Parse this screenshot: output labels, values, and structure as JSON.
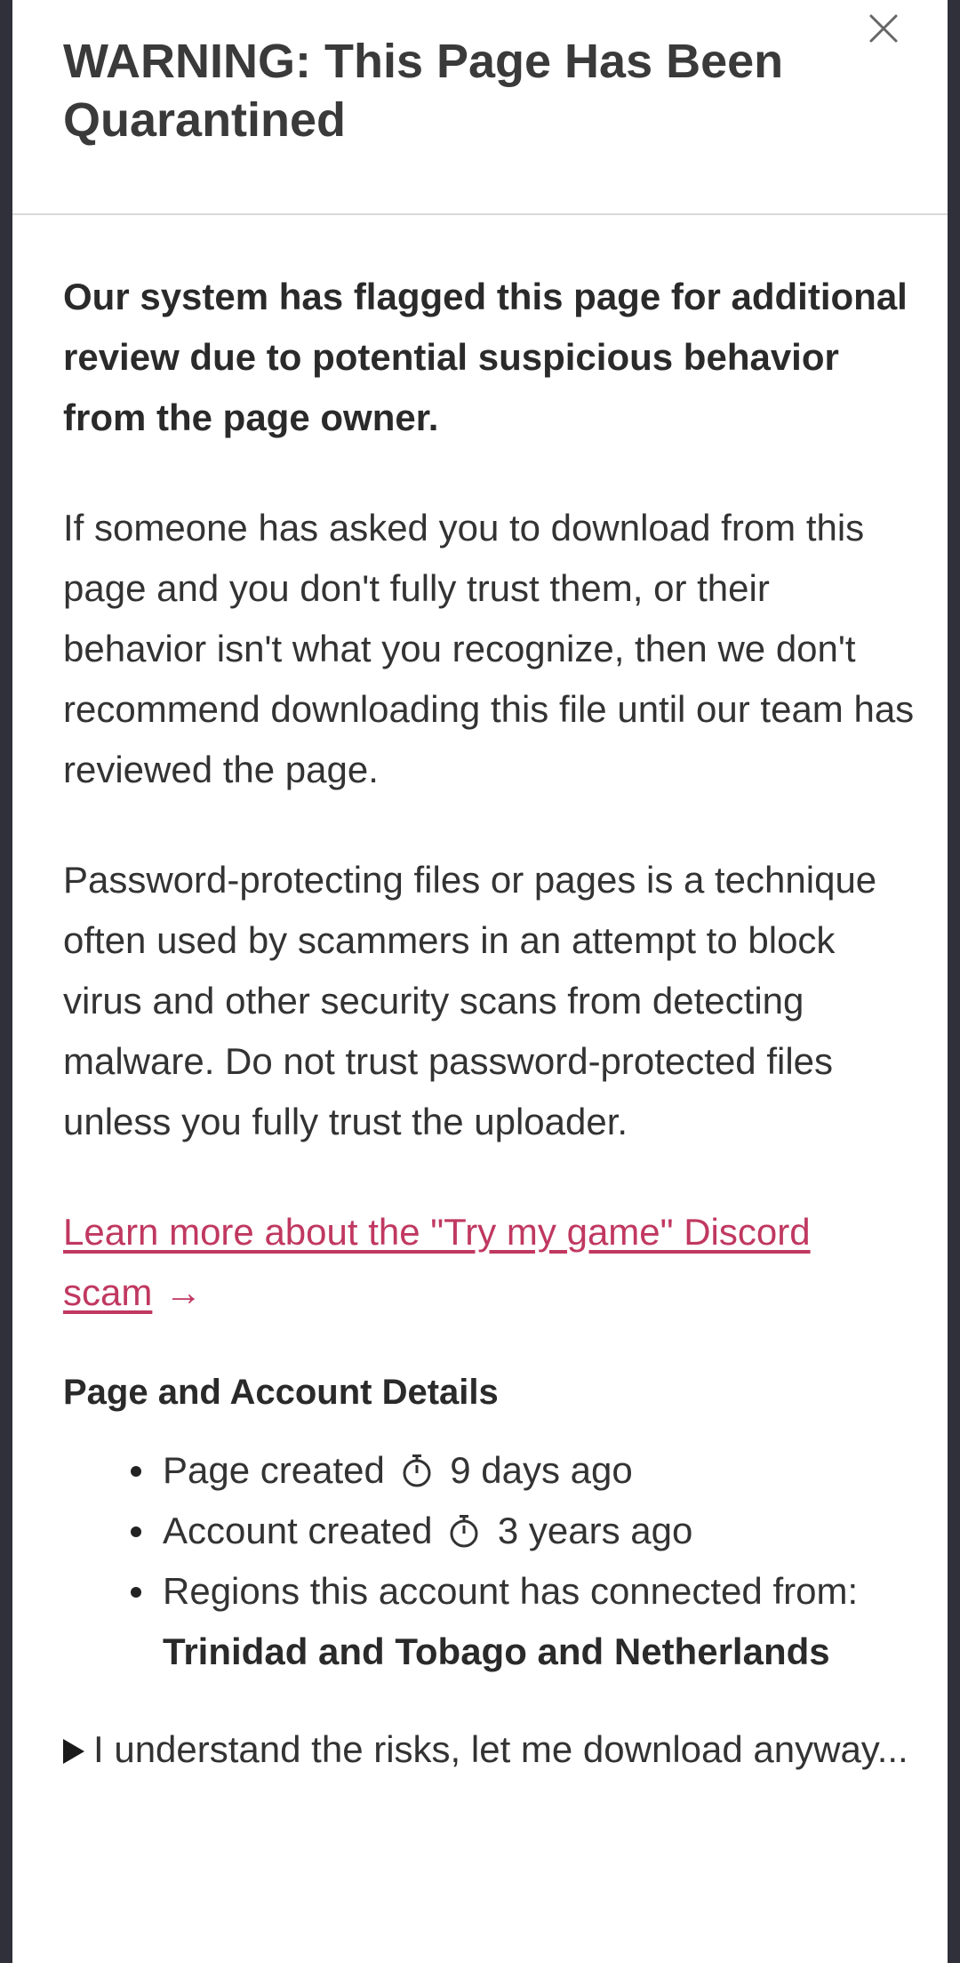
{
  "modal": {
    "title": "WARNING: This Page Has Been Quarantined",
    "close_icon": "close-icon"
  },
  "body": {
    "lead": "Our system has flagged this page for additional review due to potential suspicious behavior from the page owner.",
    "paragraph_1": "If someone has asked you to download from this page and you don't fully trust them, or their behavior isn't what you recognize, then we don't recommend downloading this file until our team has reviewed the page.",
    "paragraph_2": "Password-protecting files or pages is a technique often used by scammers in an attempt to block virus and other security scans from detecting malware. Do not trust password-protected files unless you fully trust the uploader.",
    "learn_more": {
      "label": "Learn more about the \"Try my game\" Discord scam",
      "arrow": "→",
      "color": "#c03860"
    }
  },
  "details": {
    "heading": "Page and Account Details",
    "page_created_label": "Page created",
    "page_created_value": "9 days ago",
    "account_created_label": "Account created",
    "account_created_value": "3 years ago",
    "regions_label": "Regions this account has connected from:",
    "regions_value": "Trinidad and Tobago and Netherlands",
    "timer_icon": "stopwatch-icon"
  },
  "disclosure": {
    "label": "I understand the risks, let me download anyway...",
    "icon": "triangle-right-icon"
  }
}
